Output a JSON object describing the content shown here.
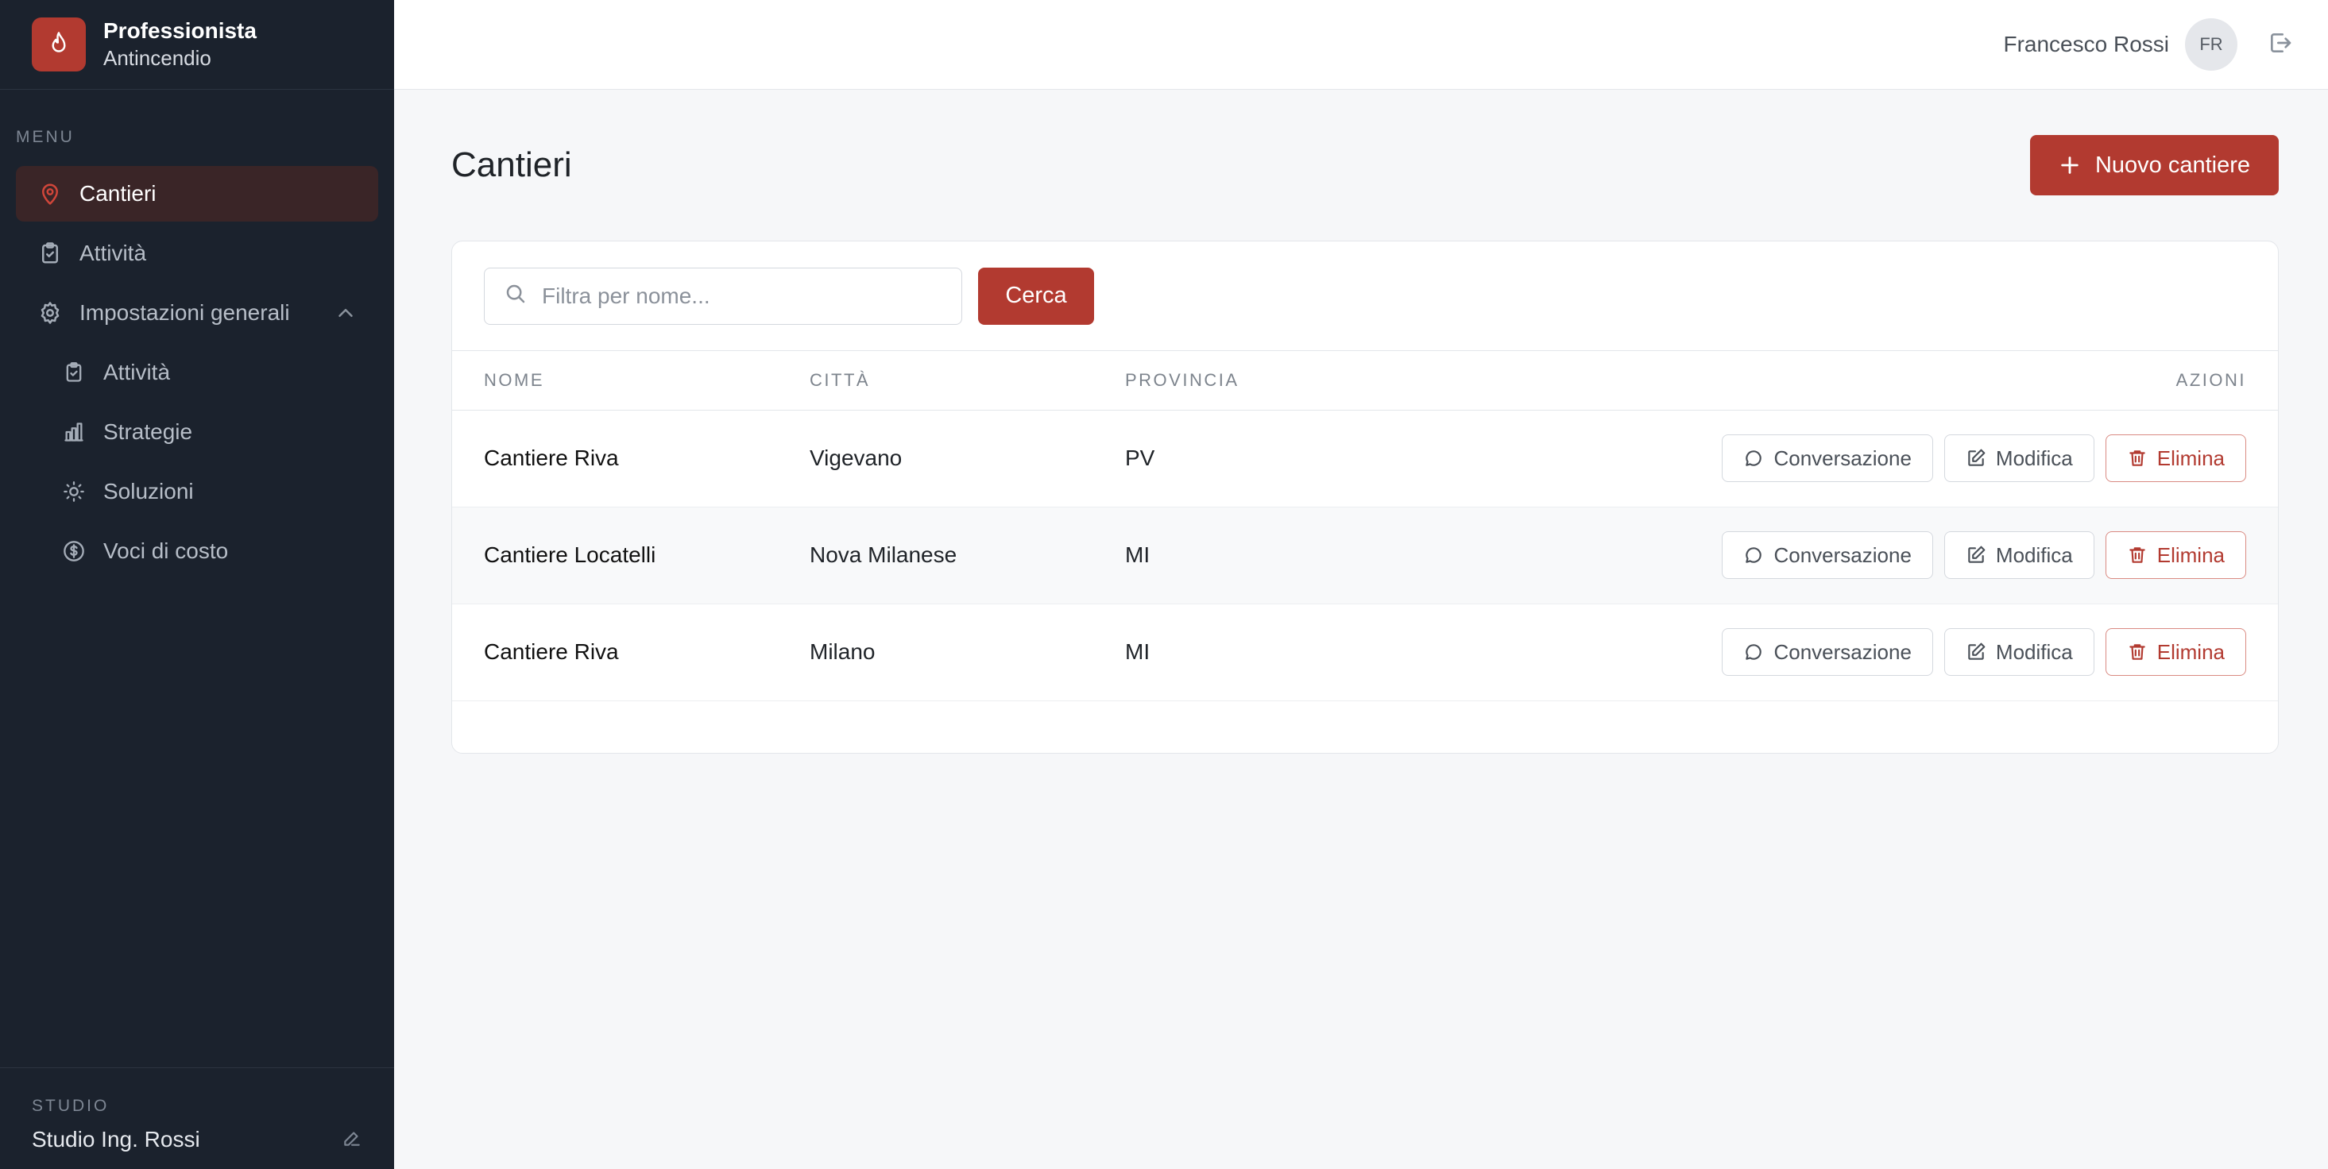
{
  "brand": {
    "title": "Professionista",
    "subtitle": "Antincendio"
  },
  "sidebar": {
    "menu_label": "MENU",
    "items": [
      {
        "label": "Cantieri",
        "icon": "map-pin-icon",
        "active": true
      },
      {
        "label": "Attività",
        "icon": "clipboard-check-icon"
      },
      {
        "label": "Impostazioni generali",
        "icon": "gear-icon",
        "expanded": true
      },
      {
        "label": "Attività",
        "icon": "clipboard-check-icon",
        "sub": true
      },
      {
        "label": "Strategie",
        "icon": "bar-chart-icon",
        "sub": true
      },
      {
        "label": "Soluzioni",
        "icon": "lightbulb-icon",
        "sub": true
      },
      {
        "label": "Voci di costo",
        "icon": "dollar-circle-icon",
        "sub": true
      }
    ],
    "studio_label": "STUDIO",
    "studio_name": "Studio Ing. Rossi"
  },
  "topbar": {
    "user_name": "Francesco Rossi",
    "avatar_initials": "FR"
  },
  "page": {
    "title": "Cantieri",
    "new_button": "Nuovo cantiere",
    "search_placeholder": "Filtra per nome...",
    "search_button": "Cerca"
  },
  "table": {
    "headers": [
      "NOME",
      "CITTÀ",
      "PROVINCIA",
      "AZIONI"
    ],
    "rows": [
      {
        "nome": "Cantiere Riva",
        "citta": "Vigevano",
        "provincia": "PV"
      },
      {
        "nome": "Cantiere Locatelli",
        "citta": "Nova Milanese",
        "provincia": "MI"
      },
      {
        "nome": "Cantiere Riva",
        "citta": "Milano",
        "provincia": "MI"
      }
    ],
    "actions": {
      "chat": "Conversazione",
      "edit": "Modifica",
      "delete": "Elimina"
    }
  },
  "colors": {
    "accent": "#b23a30",
    "sidebar_bg": "#1b222d",
    "active_bg": "#3a2527"
  }
}
